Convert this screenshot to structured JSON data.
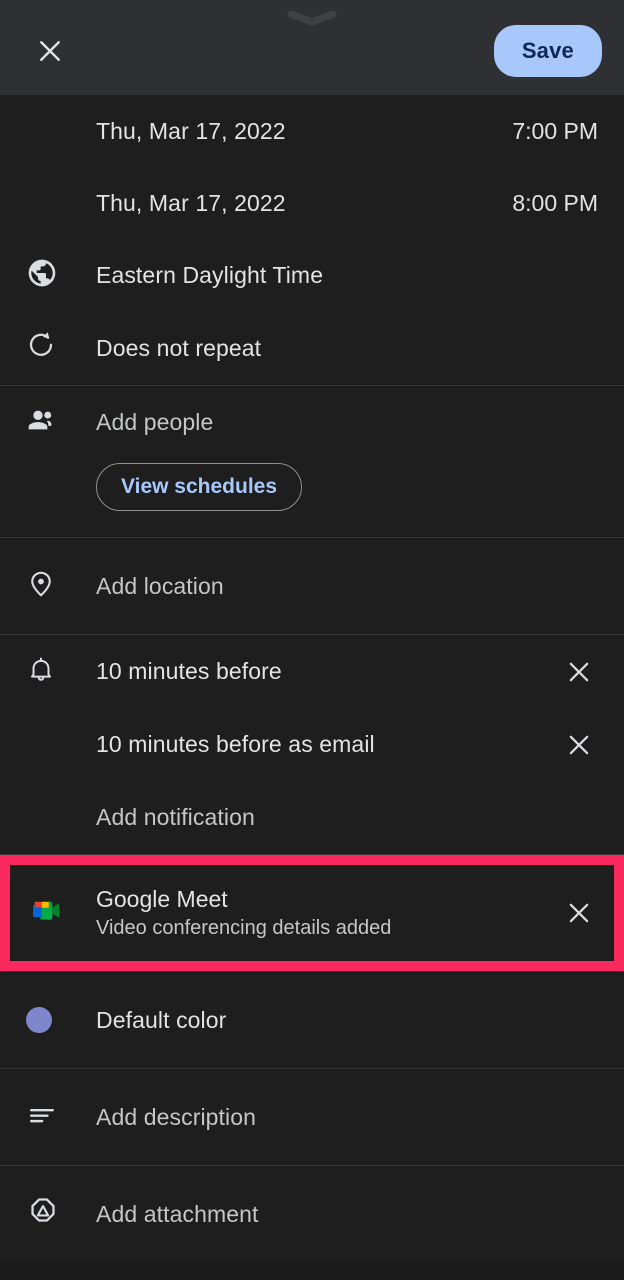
{
  "appbar": {
    "drag_handle_icon": "chevron-down-handle-icon",
    "close_icon": "close-icon",
    "save_label": "Save",
    "save_bg_color": "#a8c7fa",
    "save_text_color": "#0b2a5b"
  },
  "schedule": {
    "start": {
      "date": "Thu, Mar 17, 2022",
      "time": "7:00 PM"
    },
    "end": {
      "date": "Thu, Mar 17, 2022",
      "time": "8:00 PM"
    },
    "timezone": {
      "icon": "globe-icon",
      "label": "Eastern Daylight Time"
    },
    "recurrence": {
      "icon": "repeat-icon",
      "label": "Does not repeat"
    }
  },
  "people": {
    "icon": "people-icon",
    "add_label": "Add people",
    "view_schedules_label": "View schedules"
  },
  "location": {
    "icon": "location-pin-icon",
    "label": "Add location"
  },
  "notifications": {
    "icon": "bell-icon",
    "items": [
      {
        "label": "10 minutes before",
        "remove_icon": "close-icon"
      },
      {
        "label": "10 minutes before as email",
        "remove_icon": "close-icon"
      }
    ],
    "add_label": "Add notification"
  },
  "conferencing": {
    "icon": "google-meet-icon",
    "title": "Google Meet",
    "subtitle": "Video conferencing details added",
    "remove_icon": "close-icon",
    "highlight_color": "#fb2a5e"
  },
  "color": {
    "icon": "color-dot-icon",
    "label": "Default color",
    "swatch_color": "#7e86cc"
  },
  "description": {
    "icon": "description-lines-icon",
    "label": "Add description"
  },
  "attachment": {
    "icon": "drive-attachment-icon",
    "label": "Add attachment"
  }
}
